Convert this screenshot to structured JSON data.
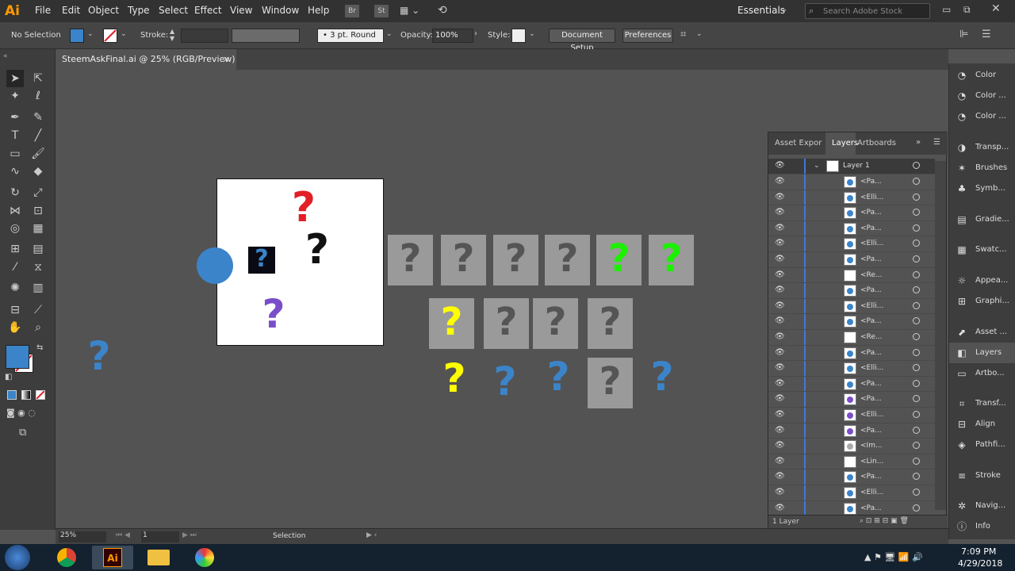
{
  "app": {
    "logo": "Ai"
  },
  "menu": [
    "File",
    "Edit",
    "Object",
    "Type",
    "Select",
    "Effect",
    "View",
    "Window",
    "Help"
  ],
  "menu_icons": [
    "Br",
    "St"
  ],
  "workspace": "Essentials",
  "search_placeholder": "Search Adobe Stock",
  "control": {
    "selection": "No Selection",
    "stroke_label": "Stroke:",
    "brush": "3 pt. Round",
    "opacity_label": "Opacity:",
    "opacity_value": "100%",
    "style_label": "Style:",
    "doc_setup": "Document Setup",
    "preferences": "Preferences"
  },
  "document_tab": {
    "title": "SteemAskFinal.ai @ 25% (RGB/Preview)",
    "close": "×"
  },
  "colors": {
    "fill": "#3b84c9",
    "blue": "#3b84c9",
    "red": "#e21f26",
    "green": "#1cf000",
    "magenta": "#ff00ff",
    "yellow": "#ffff00",
    "purple": "#7a4ec9"
  },
  "layers_panel": {
    "tabs": [
      "Asset Expor",
      "Layers",
      "Artboards"
    ],
    "layer_name": "Layer 1",
    "rows": [
      "<Pa...",
      "<Elli...",
      "<Pa...",
      "<Pa...",
      "<Elli...",
      "<Pa...",
      "<Re...",
      "<Pa...",
      "<Elli...",
      "<Pa...",
      "<Re...",
      "<Pa...",
      "<Elli...",
      "<Pa...",
      "<Pa...",
      "<Elli...",
      "<Pa...",
      "<Im...",
      "<Lin...",
      "<Pa...",
      "<Elli...",
      "<Pa..."
    ],
    "footer": "1 Layer"
  },
  "right_panels": [
    "Color",
    "Color ...",
    "Color ...",
    "Transp...",
    "Brushes",
    "Symb...",
    "Gradie...",
    "Swatc...",
    "Appea...",
    "Graphi...",
    "Asset ...",
    "Layers",
    "Artbo...",
    "Transf...",
    "Align",
    "Pathfi...",
    "Stroke",
    "Navig...",
    "Info"
  ],
  "status": {
    "zoom": "25%",
    "artboard": "1",
    "mode": "Selection"
  },
  "taskbar": {
    "time": "7:09 PM",
    "date": "4/29/2018"
  }
}
